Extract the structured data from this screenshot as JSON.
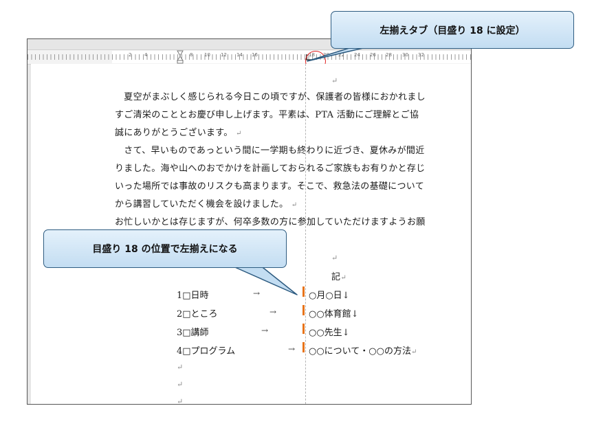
{
  "callouts": {
    "top": "左揃えタブ（目盛り 18 に設定）",
    "middle": "目盛り 18 の位置で左揃えになる"
  },
  "ruler": {
    "numbers": [
      "2",
      "4",
      "8",
      "10",
      "12",
      "14",
      "16",
      "18",
      "20",
      "22",
      "24",
      "26",
      "28",
      "30",
      "32"
    ]
  },
  "document": {
    "blank_mark": "↵",
    "lines": [
      "　夏空がまぶしく感じられる今日この頃ですが、保護者の皆様におかれまし",
      "すご清栄のこととお慶び申し上げます。平素は、PTA 活動にご理解とご協",
      "誠にありがとうございます。",
      "　さて、早いものであっという間に一学期も終わりに近づき、夏休みが間近",
      "りました。海や山へのおでかけを計画しておられるご家族もお有りかと存じ",
      "いった場所では事故のリスクも高まります。そこで、救急法の基礎について",
      "から講習していただく機会を設けました。",
      "お忙しいかとは存じますが、何卒多数の方に参加していただけますようお願"
    ],
    "ki": "記",
    "items": [
      {
        "label": "1□日時",
        "arrow": "→",
        "value": "○月○日↓"
      },
      {
        "label": "2□ところ",
        "arrow": "→",
        "value": "○○体育館↓"
      },
      {
        "label": "3□講師",
        "arrow": "→",
        "value": "○○先生↓"
      },
      {
        "label": "4□プログラム",
        "arrow": "→",
        "value": "○○について・○○の方法"
      }
    ]
  },
  "colors": {
    "highlight_circle": "#e02020",
    "tab_bar": "#e8741a",
    "callout_border": "#2d5b80"
  }
}
